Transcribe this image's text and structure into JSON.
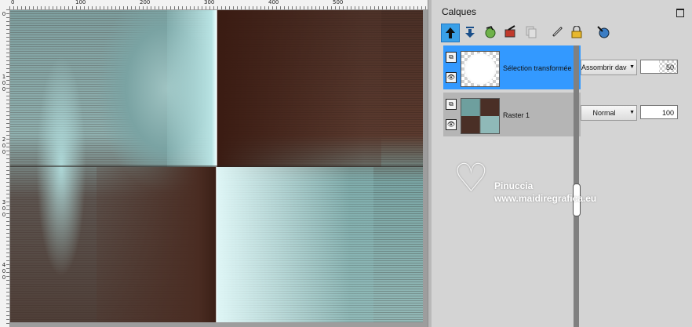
{
  "ruler": {
    "top_labels": [
      "0",
      "100",
      "200",
      "300",
      "400",
      "500"
    ],
    "left_labels": [
      "0",
      "100",
      "200",
      "300",
      "400"
    ]
  },
  "panel": {
    "title": "Calques"
  },
  "toolbar": {
    "icons": [
      "move-layer-up-icon",
      "move-layer-down-icon",
      "new-layer-icon",
      "delete-layer-icon",
      "duplicate-layer-icon",
      "link-layer-icon",
      "lock-layer-icon",
      "layer-properties-icon"
    ]
  },
  "layers": [
    {
      "name": "Sélection transformée",
      "blend_mode": "Assombrir davantage",
      "opacity": "50",
      "opacity_fraction": 0.5,
      "selected": true
    },
    {
      "name": "Raster 1",
      "blend_mode": "Normal",
      "opacity": "100",
      "opacity_fraction": 1.0,
      "selected": false
    }
  ],
  "watermark": {
    "name": "Pinuccia",
    "url": "www.maidiregrafica.eu"
  },
  "colors": {
    "selection_blue": "#3399ff",
    "active_tool_blue": "#3aa0e8"
  }
}
